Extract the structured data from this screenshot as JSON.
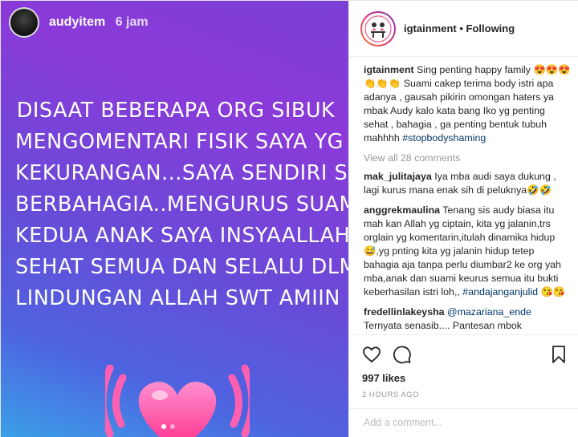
{
  "story": {
    "username": "audyitem",
    "time": "6 jam",
    "lines": [
      "DISAAT BEBERAPA ORG SIBUK",
      "MENGOMENTARI FISIK SAYA YG BNYK",
      "KEKURANGAN...SAYA SENDIRI SIBUK",
      "BERBAHAGIA..MENGURUS SUAMI DAN",
      "KEDUA ANAK SAYA INSYAALLAH",
      "SEHAT SEMUA DAN SELALU DLM",
      "LINDUNGAN ALLAH SWT AMIIN"
    ],
    "end_emoji": "🙏",
    "carousel_count": 2,
    "carousel_active": 1
  },
  "post": {
    "username": "igtainment",
    "follow_label": "• Following"
  },
  "caption": {
    "user": "igtainment",
    "text": "Sing penting happy family 😍😍😍👏👏👏 Suami cakep terima body istri apa adanya , gausah pikirin omongan haters ya mbak Audy kalo kata bang Iko yg penting sehat , bahagia , ga penting bentuk tubuh mahhhh",
    "hashtag": "#stopbodyshaming"
  },
  "view_all": "View all 28 comments",
  "comments": [
    {
      "user": "mak_julitajaya",
      "text": "Iya mba audi saya dukung , lagi kurus mana enak sih di peluknya🤣🤣",
      "tag": ""
    },
    {
      "user": "anggrekmaulina",
      "text": "Tenang sis audy biasa itu mah kan Allah yg ciptain, kita yg jalanin,trs orglain yg komentarin,itulah dinamika hidup😅,yg pnting kita yg jalanin hidup tetep bahagia aja tanpa perlu diumbar2 ke org yah mba,anak dan suami keurus semua itu bukti keberhasilan istri loh,,",
      "tag": "#andajanganjulid 😘😘"
    },
    {
      "user": "fredellinlakeysha",
      "text": "",
      "tag": "@mazariana_ende"
    },
    {
      "user": "",
      "text": "Ternyata senasib.... Pantesan mbok",
      "tag": ""
    }
  ],
  "likes": "997 likes",
  "ago": "2 HOURS AGO",
  "add_comment_placeholder": "Add a comment...",
  "icons": [
    "heart-icon",
    "comment-icon",
    "bookmark-icon"
  ],
  "colors": {
    "link": "#003569",
    "muted": "#999999",
    "gradient_top": "#8b3ad9",
    "gradient_bottom": "#3aa0e8"
  }
}
